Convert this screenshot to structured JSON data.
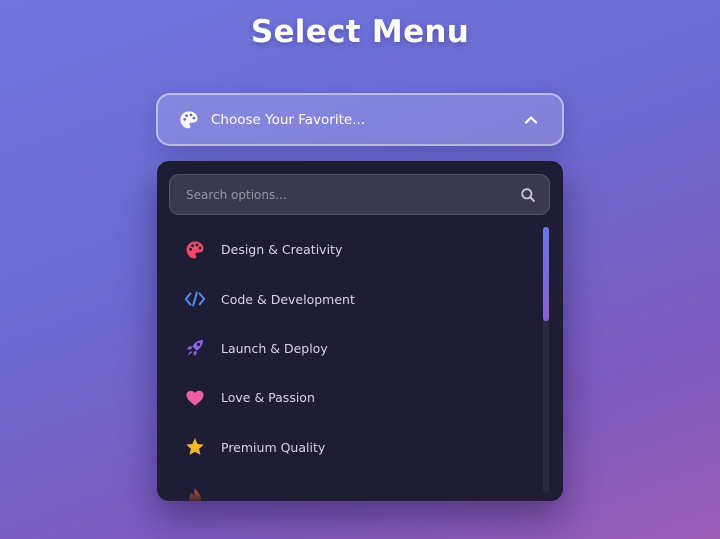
{
  "page": {
    "title": "Select Menu"
  },
  "select": {
    "icon": "palette-icon",
    "label": "Choose Your Favorite...",
    "chevron": "chevron-up-icon",
    "expanded": true
  },
  "search": {
    "placeholder": "Search options...",
    "value": "",
    "icon": "search-icon"
  },
  "options": [
    {
      "label": "Design & Creativity",
      "icon": "palette-icon",
      "color": "#f0476a"
    },
    {
      "label": "Code & Development",
      "icon": "code-icon",
      "color": "#4f8df0"
    },
    {
      "label": "Launch & Deploy",
      "icon": "rocket-icon",
      "color": "#8d63e8"
    },
    {
      "label": "Love & Passion",
      "icon": "heart-icon",
      "color": "#ec5fa4"
    },
    {
      "label": "Premium Quality",
      "icon": "star-icon",
      "color": "#f6b823"
    },
    {
      "label": "",
      "icon": "fire-icon",
      "color": "#f26b33"
    }
  ],
  "colors": {
    "panel_background": "#1f1d35",
    "scroll_thumb": "#7a6be0"
  }
}
